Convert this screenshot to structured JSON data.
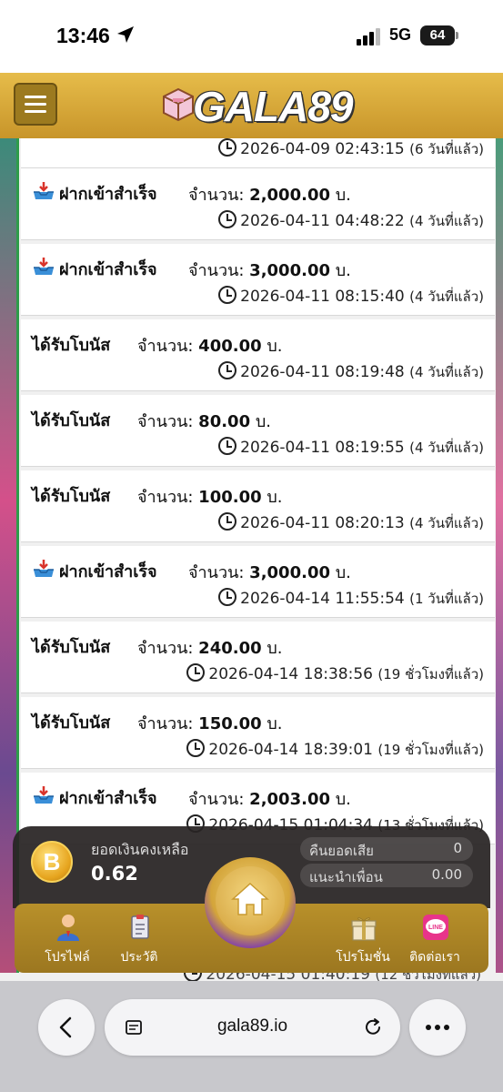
{
  "status": {
    "time": "13:46",
    "network": "5G",
    "battery": "64"
  },
  "header": {
    "logo": "GALA89"
  },
  "currency": "บ.",
  "amount_label": "จำนวน:",
  "transactions": [
    {
      "type": "",
      "amount": "",
      "time": "2026-04-09 02:43:15",
      "rel": "(6 วันที่แล้ว)"
    },
    {
      "type": "ฝากเข้าสำเร็จ",
      "amount": "2,000.00",
      "time": "2026-04-11 04:48:22",
      "rel": "(4 วันที่แล้ว)"
    },
    {
      "type": "ฝากเข้าสำเร็จ",
      "amount": "3,000.00",
      "time": "2026-04-11 08:15:40",
      "rel": "(4 วันที่แล้ว)"
    },
    {
      "type": "ได้รับโบนัส",
      "amount": "400.00",
      "time": "2026-04-11 08:19:48",
      "rel": "(4 วันที่แล้ว)"
    },
    {
      "type": "ได้รับโบนัส",
      "amount": "80.00",
      "time": "2026-04-11 08:19:55",
      "rel": "(4 วันที่แล้ว)"
    },
    {
      "type": "ได้รับโบนัส",
      "amount": "100.00",
      "time": "2026-04-11 08:20:13",
      "rel": "(4 วันที่แล้ว)"
    },
    {
      "type": "ฝากเข้าสำเร็จ",
      "amount": "3,000.00",
      "time": "2026-04-14 11:55:54",
      "rel": "(1 วันที่แล้ว)"
    },
    {
      "type": "ได้รับโบนัส",
      "amount": "240.00",
      "time": "2026-04-14 18:38:56",
      "rel": "(19 ชั่วโมงที่แล้ว)"
    },
    {
      "type": "ได้รับโบนัส",
      "amount": "150.00",
      "time": "2026-04-14 18:39:01",
      "rel": "(19 ชั่วโมงที่แล้ว)"
    },
    {
      "type": "ฝากเข้าสำเร็จ",
      "amount": "2,003.00",
      "time": "2026-04-15 01:04:34",
      "rel": "(13 ชั่วโมงที่แล้ว)"
    },
    {
      "type": "",
      "amount": "",
      "time": "2026-04-15 01:40:19",
      "rel": "(12 ชั่วโมงที่แล้ว)"
    }
  ],
  "balance": {
    "label": "ยอดเงินคงเหลือ",
    "value": "0.62",
    "coin_letter": "B",
    "cashback_label": "คืนยอดเสีย",
    "cashback_value": "0",
    "referral_label": "แนะนำเพื่อน",
    "referral_value": "0.00"
  },
  "nav": {
    "profile": "โปรไฟล์",
    "history": "ประวัติ",
    "promotion": "โปรโมชั่น",
    "contact": "ติดต่อเรา",
    "line_badge": "LINE"
  },
  "browser": {
    "url": "gala89.io"
  },
  "colors": {
    "header_gold": "#e6bc4a",
    "nav_gold": "#b8902a",
    "accent_green": "#2e9c4a"
  },
  "icons": [
    "location-arrow-icon",
    "signal-icon",
    "battery-icon",
    "menu-icon",
    "logo-box-icon",
    "deposit-tray-icon",
    "clock-icon",
    "coin-icon",
    "profile-icon",
    "history-icon",
    "home-icon",
    "gift-icon",
    "line-icon",
    "back-icon",
    "reader-icon",
    "reload-icon",
    "more-icon"
  ]
}
